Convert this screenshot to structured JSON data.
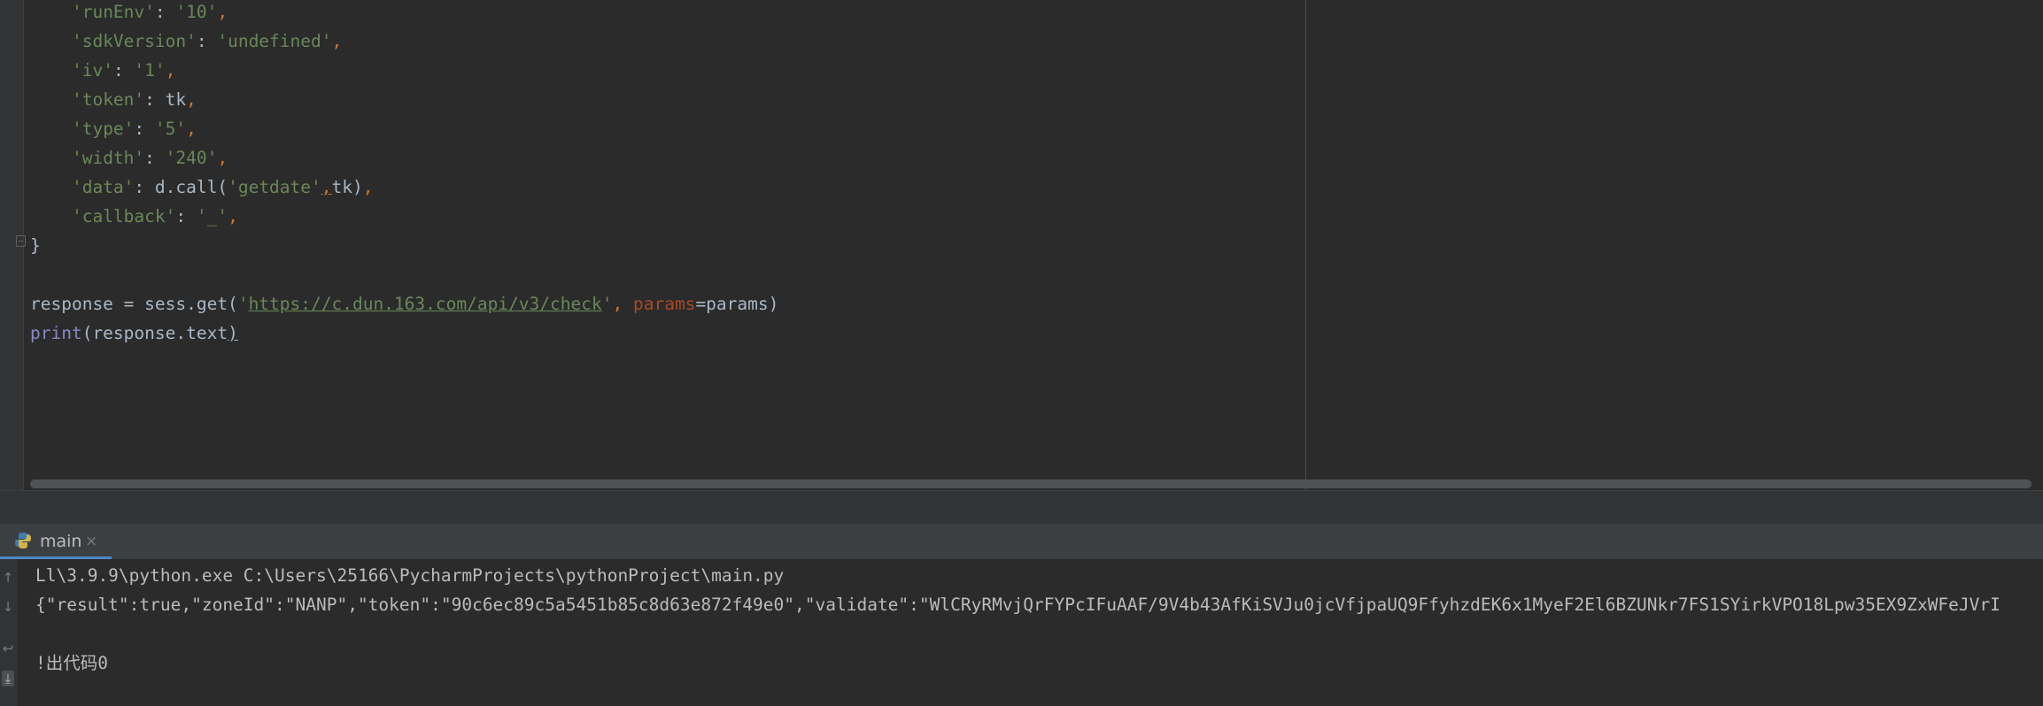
{
  "editor": {
    "lines": [
      {
        "key": "'runEnv'",
        "sep": ": ",
        "value": "'10'",
        "comma": ","
      },
      {
        "key": "'sdkVersion'",
        "sep": ": ",
        "value": "'undefined'",
        "comma": ","
      },
      {
        "key": "'iv'",
        "sep": ": ",
        "value": "'1'",
        "comma": ","
      },
      {
        "key": "'token'",
        "sep": ": ",
        "value": "tk",
        "comma": ","
      },
      {
        "key": "'type'",
        "sep": ": ",
        "value": "'5'",
        "comma": ","
      },
      {
        "key": "'width'",
        "sep": ": ",
        "value": "'240'",
        "comma": ","
      }
    ],
    "data_line": {
      "key": "'data'",
      "sep": ": ",
      "prefix": "d.call(",
      "arg1": "'getdate'",
      "comma1": ",",
      "arg2": "tk)",
      "comma2": ","
    },
    "callback_line": {
      "key": "'callback'",
      "sep": ": ",
      "value": "'_'",
      "comma": ","
    },
    "closing_brace": "}",
    "response_line": {
      "var": "response = sess.get(",
      "url_quote_open": "'",
      "url": "https://c.dun.163.com/api/v3/check",
      "url_quote_close": "'",
      "comma": ",",
      "param_name": "params",
      "rest": "=params)"
    },
    "print_line": {
      "builtin": "print",
      "rest": "(response.text",
      "close": ")"
    }
  },
  "run_panel": {
    "tab_label": "main",
    "close_glyph": "×",
    "icon": "python-icon",
    "console_lines": [
      "Ll\\3.9.9\\python.exe C:\\Users\\25166\\PycharmProjects\\pythonProject\\main.py",
      "{\"result\":true,\"zoneId\":\"NANP\",\"token\":\"90c6ec89c5a5451b85c8d63e872f49e0\",\"validate\":\"WlCRyRMvjQrFYPcIFuAAF/9V4b43AfKiSVJu0jcVfjpaUQ9FfyhzdEK6x1MyeF2El6BZUNkr7FS1SYirkVPO18Lpw35EX9ZxWFeJVrI",
      "",
      "!出代码0"
    ],
    "gutter_icons": [
      "up-arrow-icon",
      "down-arrow-icon",
      "soft-wrap-icon",
      "scroll-to-end-icon"
    ]
  },
  "colors": {
    "background": "#2b2b2b",
    "string": "#6a8759",
    "keyword_comma": "#cc7832",
    "param": "#aa4926",
    "builtin": "#8888c6",
    "text": "#a9b7c6",
    "tab_underline": "#4a88c7"
  }
}
